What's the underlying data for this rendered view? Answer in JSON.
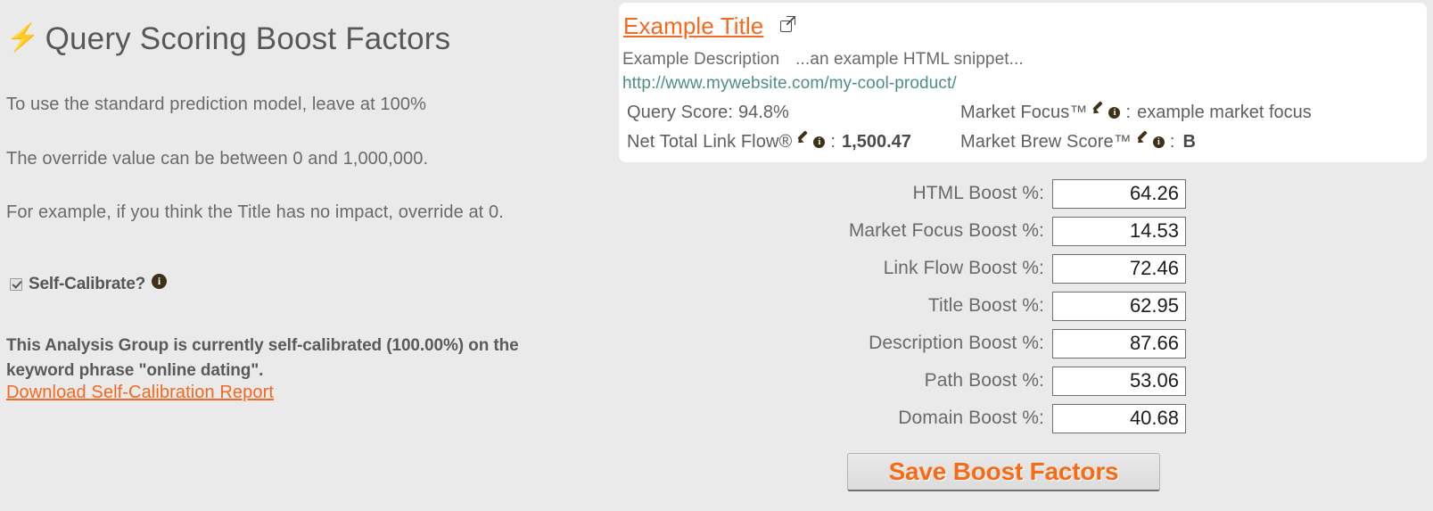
{
  "colors": {
    "background": "#eaeaea",
    "accent_orange": "#f4681f",
    "url_teal": "#4d8f86",
    "text_gray": "#6a6a6a",
    "icon_brown": "#3f3117",
    "card_white": "#ffffff"
  },
  "left": {
    "bolt_icon": "bolt-icon",
    "title": "Query Scoring Boost Factors",
    "intro_1": "To use the standard prediction model, leave at 100%",
    "intro_2": "The override value can be between 0 and 1,000,000.",
    "intro_3": "For example, if you think the Title has no impact, override at 0.",
    "self_calibrate_label": "Self-Calibrate?",
    "self_calibrate_checked": true,
    "self_calibrate_info_icon": "info-icon",
    "calibration_status": "This Analysis Group is currently self-calibrated (100.00%) on the keyword phrase \"online dating\".",
    "download_link": "Download Self-Calibration Report"
  },
  "card": {
    "title": "Example Title",
    "external_link_icon": "external-link-icon",
    "description": "Example Description",
    "snippet": "...an example HTML snippet...",
    "url": "http://www.mywebsite.com/my-cool-product/",
    "metrics": [
      {
        "label": "Query Score:",
        "value": "94.8%",
        "bold": false,
        "has_pencil": false,
        "has_info": false
      },
      {
        "label": "Market Focus™",
        "value": "example market focus",
        "bold": false,
        "has_pencil": true,
        "has_info": true,
        "separator": ":"
      },
      {
        "label": "Net Total Link Flow®",
        "value": "1,500.47",
        "bold": true,
        "has_pencil": true,
        "has_info": true,
        "separator": ":"
      },
      {
        "label": "Market Brew Score™",
        "value": "B",
        "bold": true,
        "has_pencil": true,
        "has_info": true,
        "separator": ":"
      }
    ]
  },
  "form": {
    "fields": [
      {
        "label": "HTML Boost %:",
        "value": "64.26"
      },
      {
        "label": "Market Focus Boost %:",
        "value": "14.53"
      },
      {
        "label": "Link Flow Boost %:",
        "value": "72.46"
      },
      {
        "label": "Title Boost %:",
        "value": "62.95"
      },
      {
        "label": "Description Boost %:",
        "value": "87.66"
      },
      {
        "label": "Path Boost %:",
        "value": "53.06"
      },
      {
        "label": "Domain Boost %:",
        "value": "40.68"
      }
    ],
    "save_label": "Save Boost Factors"
  }
}
